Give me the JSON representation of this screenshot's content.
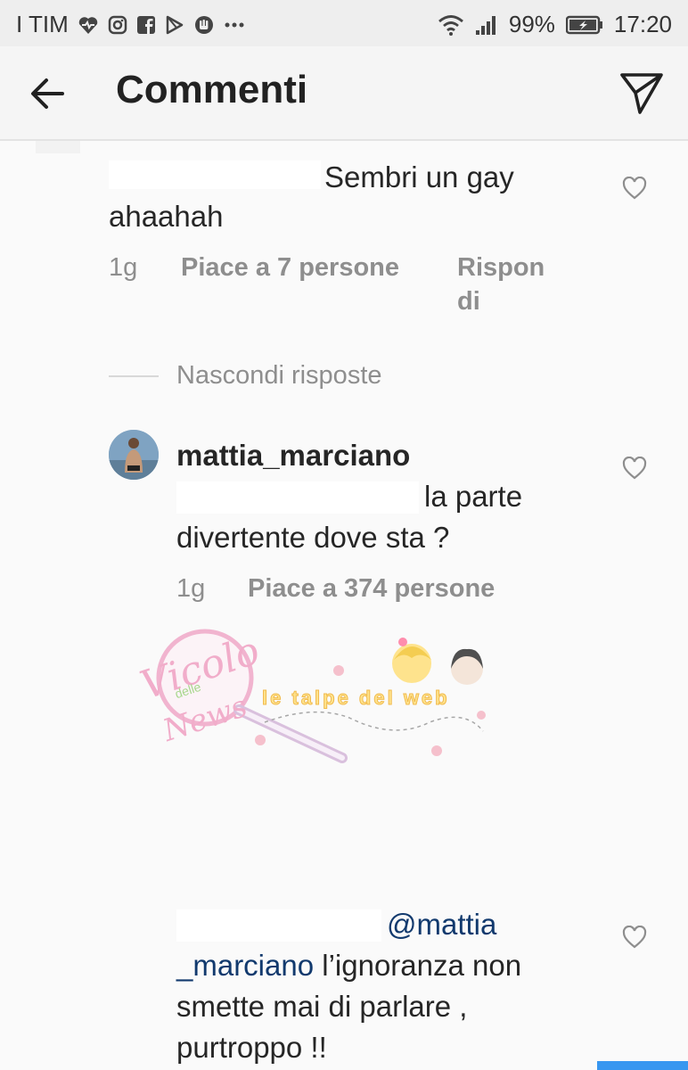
{
  "status_bar": {
    "carrier": "I TIM",
    "battery": "99%",
    "time": "17:20"
  },
  "header": {
    "title": "Commenti"
  },
  "comments": [
    {
      "username_hidden": true,
      "text_line1": "Sembri un gay",
      "text_line2": "ahaahah",
      "age": "1g",
      "likes": "Piace a 7 persone",
      "reply_line1": "Rispon",
      "reply_line2": "di"
    }
  ],
  "replies_toggle": "Nascondi risposte",
  "reply": {
    "username": "mattia_marciano",
    "text_line1": "la parte",
    "text_line2": "divertente dove sta ?",
    "age": "1g",
    "likes": "Piace a 374 persone"
  },
  "reply2": {
    "mention_line1": "@mattia",
    "mention_line2": "_marciano",
    "text_line2_rest": " l’ignoranza non",
    "text_line3": "smette mai di parlare ,",
    "text_line4": "purtroppo !!"
  },
  "watermark": {
    "brand1": "Vicolo",
    "brand1_small": "delle",
    "brand1_tail": "News",
    "brand2": "le talpe del web"
  },
  "colors": {
    "link": "#123a6e",
    "meta_gray": "#8e8e8e",
    "accent_blue": "#3897f0"
  }
}
